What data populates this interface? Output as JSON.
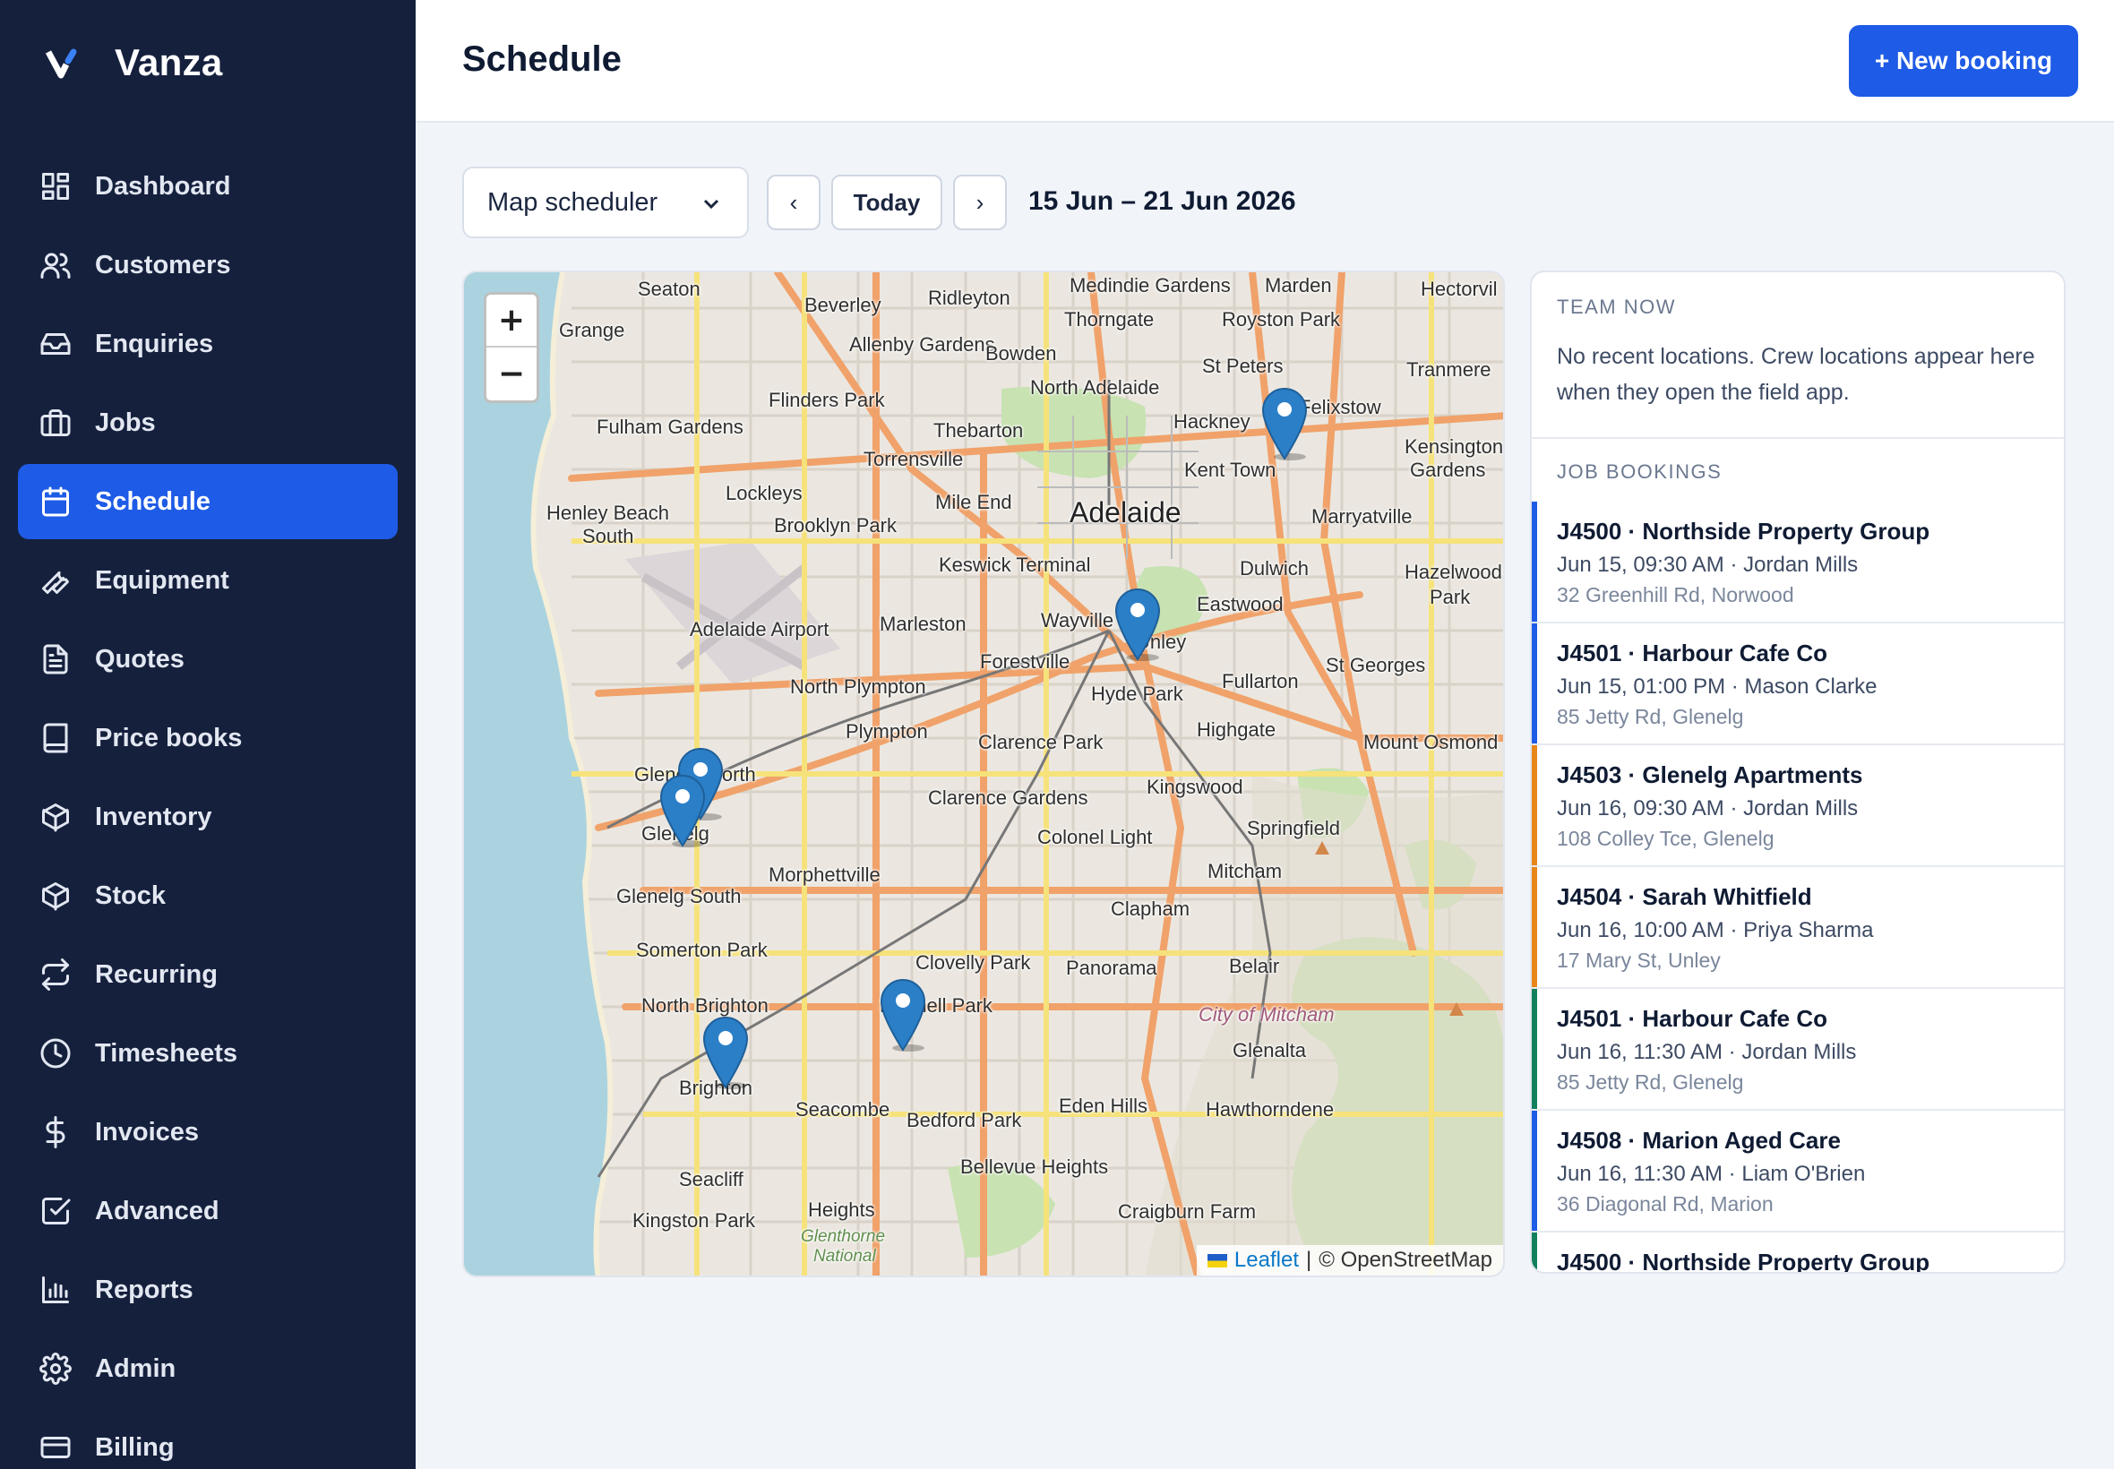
{
  "app": {
    "name": "Vanza"
  },
  "sidebar": {
    "items": [
      {
        "label": "Dashboard",
        "icon": "dashboard-icon",
        "active": false
      },
      {
        "label": "Customers",
        "icon": "users-icon",
        "active": false
      },
      {
        "label": "Enquiries",
        "icon": "inbox-icon",
        "active": false
      },
      {
        "label": "Jobs",
        "icon": "briefcase-icon",
        "active": false
      },
      {
        "label": "Schedule",
        "icon": "calendar-icon",
        "active": true
      },
      {
        "label": "Equipment",
        "icon": "wrench-icon",
        "active": false
      },
      {
        "label": "Quotes",
        "icon": "document-icon",
        "active": false
      },
      {
        "label": "Price books",
        "icon": "book-icon",
        "active": false
      },
      {
        "label": "Inventory",
        "icon": "box-icon",
        "active": false
      },
      {
        "label": "Stock",
        "icon": "box-icon",
        "active": false
      },
      {
        "label": "Recurring",
        "icon": "repeat-icon",
        "active": false
      },
      {
        "label": "Timesheets",
        "icon": "clock-icon",
        "active": false
      },
      {
        "label": "Invoices",
        "icon": "dollar-icon",
        "active": false
      },
      {
        "label": "Advanced",
        "icon": "checkbox-icon",
        "active": false
      },
      {
        "label": "Reports",
        "icon": "bar-chart-icon",
        "active": false
      },
      {
        "label": "Admin",
        "icon": "gear-icon",
        "active": false
      },
      {
        "label": "Billing",
        "icon": "credit-card-icon",
        "active": false
      }
    ]
  },
  "header": {
    "title": "Schedule",
    "new_booking_label": "+ New booking"
  },
  "controls": {
    "view_select": "Map scheduler",
    "prev_label": "‹",
    "today_label": "Today",
    "next_label": "›",
    "date_range": "15 Jun – 21 Jun 2026"
  },
  "map": {
    "zoom_in": "+",
    "zoom_out": "−",
    "attribution_link": "Leaflet",
    "attribution_separator": "|",
    "attribution_text": "© OpenStreetMap",
    "marker_count": 7,
    "places": [
      "Seaton",
      "Beverley",
      "Ridleyton",
      "Medindie Gardens",
      "Marden",
      "Hectorvil",
      "Grange",
      "Thorngate",
      "Royston Park",
      "Allenby Gardens",
      "Bowden",
      "St Peters",
      "Tranmere",
      "Flinders Park",
      "North Adelaide",
      "Fulham Gardens",
      "Thebarton",
      "Hackney",
      "Felixstow",
      "Kensington",
      "Gardens",
      "Torrensville",
      "Kent Town",
      "Lockleys",
      "Mile End",
      "Adelaide",
      "Marryatville",
      "Henley Beach",
      "South",
      "Brooklyn Park",
      "Keswick Terminal",
      "Dulwich",
      "Hazelwood",
      "Park",
      "Adelaide Airport",
      "Marleston",
      "Wayville",
      "Unley",
      "Eastwood",
      "Forestville",
      "St Georges",
      "North Plympton",
      "Hyde Park",
      "Fullarton",
      "Plympton",
      "Clarence Park",
      "Highgate",
      "Mount Osmond",
      "Glenelg North",
      "Kingswood",
      "Clarence Gardens",
      "Glenelg",
      "Springfield",
      "Colonel Light",
      "Mitcham",
      "Morphettville",
      "Glenelg South",
      "Clapham",
      "Somerton Park",
      "Clovelly Park",
      "Panorama",
      "Belair",
      "North Brighton",
      "Mitchell Park",
      "City of Mitcham",
      "Glenalta",
      "Brighton",
      "Seacombe",
      "Bedford Park",
      "Eden Hills",
      "Hawthorndene",
      "Bellevue Heights",
      "Seacliff",
      "Craigburn Farm",
      "Heights",
      "Kingston Park",
      "Glenthorne",
      "National"
    ]
  },
  "panel": {
    "team_label": "TEAM NOW",
    "team_note": "No recent locations. Crew locations appear here when they open the field app.",
    "jobs_label": "JOB BOOKINGS",
    "jobs": [
      {
        "title": "J4500 · Northside Property Group",
        "meta": "Jun 15, 09:30 AM · Jordan Mills",
        "address": "32 Greenhill Rd, Norwood",
        "color": "#1e5be6"
      },
      {
        "title": "J4501 · Harbour Cafe Co",
        "meta": "Jun 15, 01:00 PM · Mason Clarke",
        "address": "85 Jetty Rd, Glenelg",
        "color": "#1e5be6"
      },
      {
        "title": "J4503 · Glenelg Apartments",
        "meta": "Jun 16, 09:30 AM · Jordan Mills",
        "address": "108 Colley Tce, Glenelg",
        "color": "#e8861a"
      },
      {
        "title": "J4504 · Sarah Whitfield",
        "meta": "Jun 16, 10:00 AM · Priya Sharma",
        "address": "17 Mary St, Unley",
        "color": "#e8861a"
      },
      {
        "title": "J4501 · Harbour Cafe Co",
        "meta": "Jun 16, 11:30 AM · Jordan Mills",
        "address": "85 Jetty Rd, Glenelg",
        "color": "#12805c"
      },
      {
        "title": "J4508 · Marion Aged Care",
        "meta": "Jun 16, 11:30 AM · Liam O'Brien",
        "address": "36 Diagonal Rd, Marion",
        "color": "#1e5be6"
      },
      {
        "title": "J4500 · Northside Property Group",
        "meta": "",
        "address": "",
        "color": "#12805c"
      }
    ]
  },
  "colors": {
    "sidebar_bg": "#15203d",
    "accent": "#1e5be6",
    "marker": "#2b7fc7"
  }
}
